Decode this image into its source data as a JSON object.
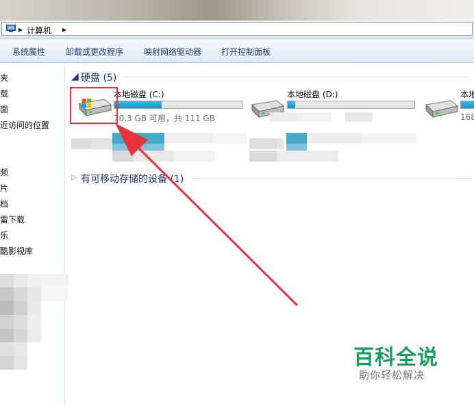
{
  "address": {
    "crumbs": [
      "计算机"
    ]
  },
  "toolbar": {
    "items": [
      "系统属性",
      "卸载或更改程序",
      "映射网络驱动器",
      "打开控制面板"
    ]
  },
  "nav": {
    "items": [
      "夹",
      "载",
      "面",
      "近访问的位置",
      "频",
      "片",
      "档",
      "雷下载",
      "乐",
      "酷影视库"
    ]
  },
  "groups": {
    "hard_disks": "硬盘 (5)",
    "removable": "有可移动存储的设备 (1)"
  },
  "drives": [
    {
      "name": "本地磁盘 (C:)",
      "free_text": "70.3 GB 可用，共 111 GB",
      "used_fraction": 0.37
    },
    {
      "name": "本地磁盘 (D:)",
      "free_text": "",
      "used_fraction": 0.06
    },
    {
      "name": "本地",
      "free_text": "168",
      "used_fraction": 0.5
    }
  ],
  "watermark": {
    "title": "百科全说",
    "subtitle": "助你轻松解决"
  },
  "colors": {
    "highlight": "#e8323a",
    "brand_green": "#18a05b"
  }
}
